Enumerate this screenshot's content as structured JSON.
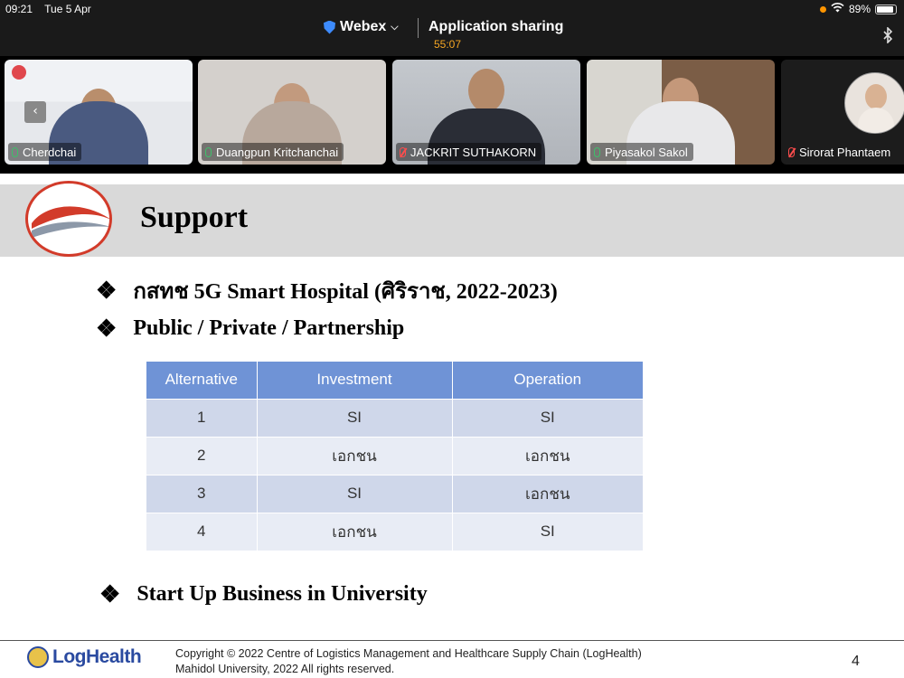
{
  "status_bar": {
    "time": "09:21",
    "date": "Tue 5 Apr",
    "battery": "89%",
    "battery_level": 0.89
  },
  "header": {
    "app_name": "Webex",
    "title": "Application sharing",
    "timer": "55:07"
  },
  "participants": [
    {
      "name": "Cherdchai",
      "mic": "on",
      "tile_color": "#c7ccd4"
    },
    {
      "name": "Duangpun Kritchanchai",
      "mic": "on",
      "tile_color": "#cfcac6"
    },
    {
      "name": "JACKRIT SUTHAKORN",
      "mic": "muted",
      "tile_color": "#bfc3c8"
    },
    {
      "name": "Piyasakol Sakol",
      "mic": "on",
      "tile_color": "#8f7a65"
    },
    {
      "name": "Sirorat Phantaem",
      "mic": "muted",
      "tile_color": "#1c1c1c"
    }
  ],
  "slide": {
    "title": "Support",
    "bullets": [
      "กสทช 5G Smart Hospital (ศิริราช, 2022-2023)",
      "Public / Private / Partnership",
      "Start Up Business in University"
    ],
    "bullet_glyph": "❖",
    "table": {
      "headers": [
        "Alternative",
        "Investment",
        "Operation"
      ],
      "rows": [
        [
          "1",
          "SI",
          "SI"
        ],
        [
          "2",
          "เอกชน",
          "เอกชน"
        ],
        [
          "3",
          "SI",
          "เอกชน"
        ],
        [
          "4",
          "เอกชน",
          "SI"
        ]
      ]
    },
    "footer": {
      "logo_text": "LogHealth",
      "copyright_line1": "Copyright © 2022 Centre of Logistics Management and Healthcare Supply Chain  (LogHealth)",
      "copyright_line2": "Mahidol University, 2022 All rights reserved.",
      "page_number": "4"
    }
  },
  "colors": {
    "accent_orange": "#f5a623",
    "table_header": "#6f93d6",
    "mic_on": "#3ec06a",
    "mic_muted": "#ff4d4d"
  }
}
